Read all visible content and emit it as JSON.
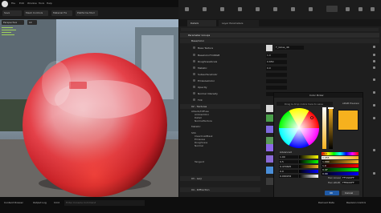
{
  "menu": {
    "items": [
      "File",
      "Edit",
      "Window",
      "Tools",
      "Help"
    ]
  },
  "toolbar": {
    "items": [
      "Save",
      "Mesh Controls",
      "Material Fix",
      "Platforms Mod"
    ]
  },
  "viewport": {
    "mode_label": "Perspective",
    "lit_label": "Lit"
  },
  "tabs": {
    "details": "Details",
    "params": "Layer Parameters"
  },
  "details": {
    "section": "Parameter Groups",
    "group": "Base/Color",
    "rows": [
      {
        "label": "Base Texture",
        "value": "T_Gloss_4K"
      },
      {
        "label": "BaseColorTintRGB",
        "value": "1.0"
      },
      {
        "label": "RoughnessScale",
        "value": "0.650"
      },
      {
        "label": "Metallic",
        "value": "0.0"
      },
      {
        "label": "SubsurfaceColor",
        "value": ""
      },
      {
        "label": "EmissiveColor",
        "value": ""
      },
      {
        "label": "Opacity",
        "value": ""
      },
      {
        "label": "Normal Intensity",
        "value": ""
      },
      {
        "label": "Tint",
        "value": "0.0"
      }
    ],
    "sub_section": "02 - Textures",
    "tree": [
      "Albedo/Diffuse",
      "AmbientOcc",
      "Detail",
      "NormalTexture",
      "Metallic",
      "SSS",
      "ClearCoatMask",
      "Emissive",
      "Roughness",
      "Normal",
      "Tangent"
    ],
    "bottom": [
      "03 - Lerp",
      "04 - Diffraction"
    ]
  },
  "picker": {
    "title": "Color Picker",
    "hint": "Drag & drop colors here to save",
    "old_new_label": "sRGB Preview",
    "advanced_label": "Advanced",
    "left_values": [
      "1.00",
      "0.5",
      "0.470625",
      "0.0",
      "0.000234"
    ],
    "right_labels": [
      "H",
      "S",
      "V",
      "R",
      "G",
      "B"
    ],
    "right_values": [
      "24.1",
      "0.955",
      "1.000",
      "1.0",
      "0.47",
      "0.00"
    ],
    "hex_linear_label": "Hex Linear",
    "hex_linear": "FF7A00FF",
    "hex_srgb_label": "Hex sRGB",
    "hex_srgb": "FFB100FF",
    "ok": "OK",
    "cancel": "Cancel",
    "colors": {
      "selected": "#f6b11e",
      "selected_dark": "#e8a22a"
    }
  },
  "statusbar": {
    "items": [
      "Content Drawer",
      "Output Log",
      "Cmd",
      "Enter Console Command"
    ],
    "right": [
      "Derived Data",
      "Revision Control"
    ]
  }
}
